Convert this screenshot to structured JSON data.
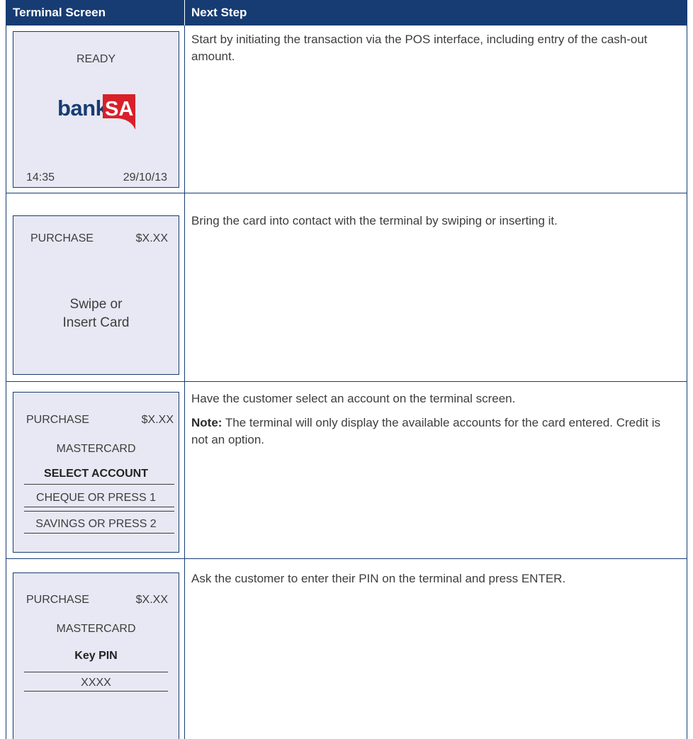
{
  "header": {
    "terminal_screen": "Terminal Screen",
    "next_step": "Next Step"
  },
  "rows": [
    {
      "screen": {
        "status": "READY",
        "logo_text_bank": "bank",
        "logo_text_sa": "SA",
        "time": "14:35",
        "date": "29/10/13"
      },
      "step": "Start by initiating the transaction via the POS interface, including entry of the cash-out amount."
    },
    {
      "screen": {
        "txn": "PURCHASE",
        "amount": "$X.XX",
        "prompt_line1": "Swipe or",
        "prompt_line2": "Insert Card"
      },
      "step": "Bring the card into contact with the terminal by swiping or inserting it."
    },
    {
      "screen": {
        "txn": "PURCHASE",
        "amount": "$X.XX",
        "card": "MASTERCARD",
        "heading": "SELECT ACCOUNT",
        "option1": "CHEQUE OR PRESS 1",
        "option2": "SAVINGS OR PRESS 2"
      },
      "step": "Have the customer select an account on the terminal screen.",
      "note_label": "Note:",
      "note_text": " The terminal will only display the available accounts for the card entered. Credit is not an option."
    },
    {
      "screen": {
        "txn": "PURCHASE",
        "amount": "$X.XX",
        "card": "MASTERCARD",
        "heading": "Key PIN",
        "pin": "XXXX"
      },
      "step": "Ask the customer to enter their PIN on the terminal and press ENTER."
    }
  ],
  "colors": {
    "header_bg": "#173c73",
    "screen_bg": "#e7e8f3",
    "logo_red": "#d8202a"
  }
}
